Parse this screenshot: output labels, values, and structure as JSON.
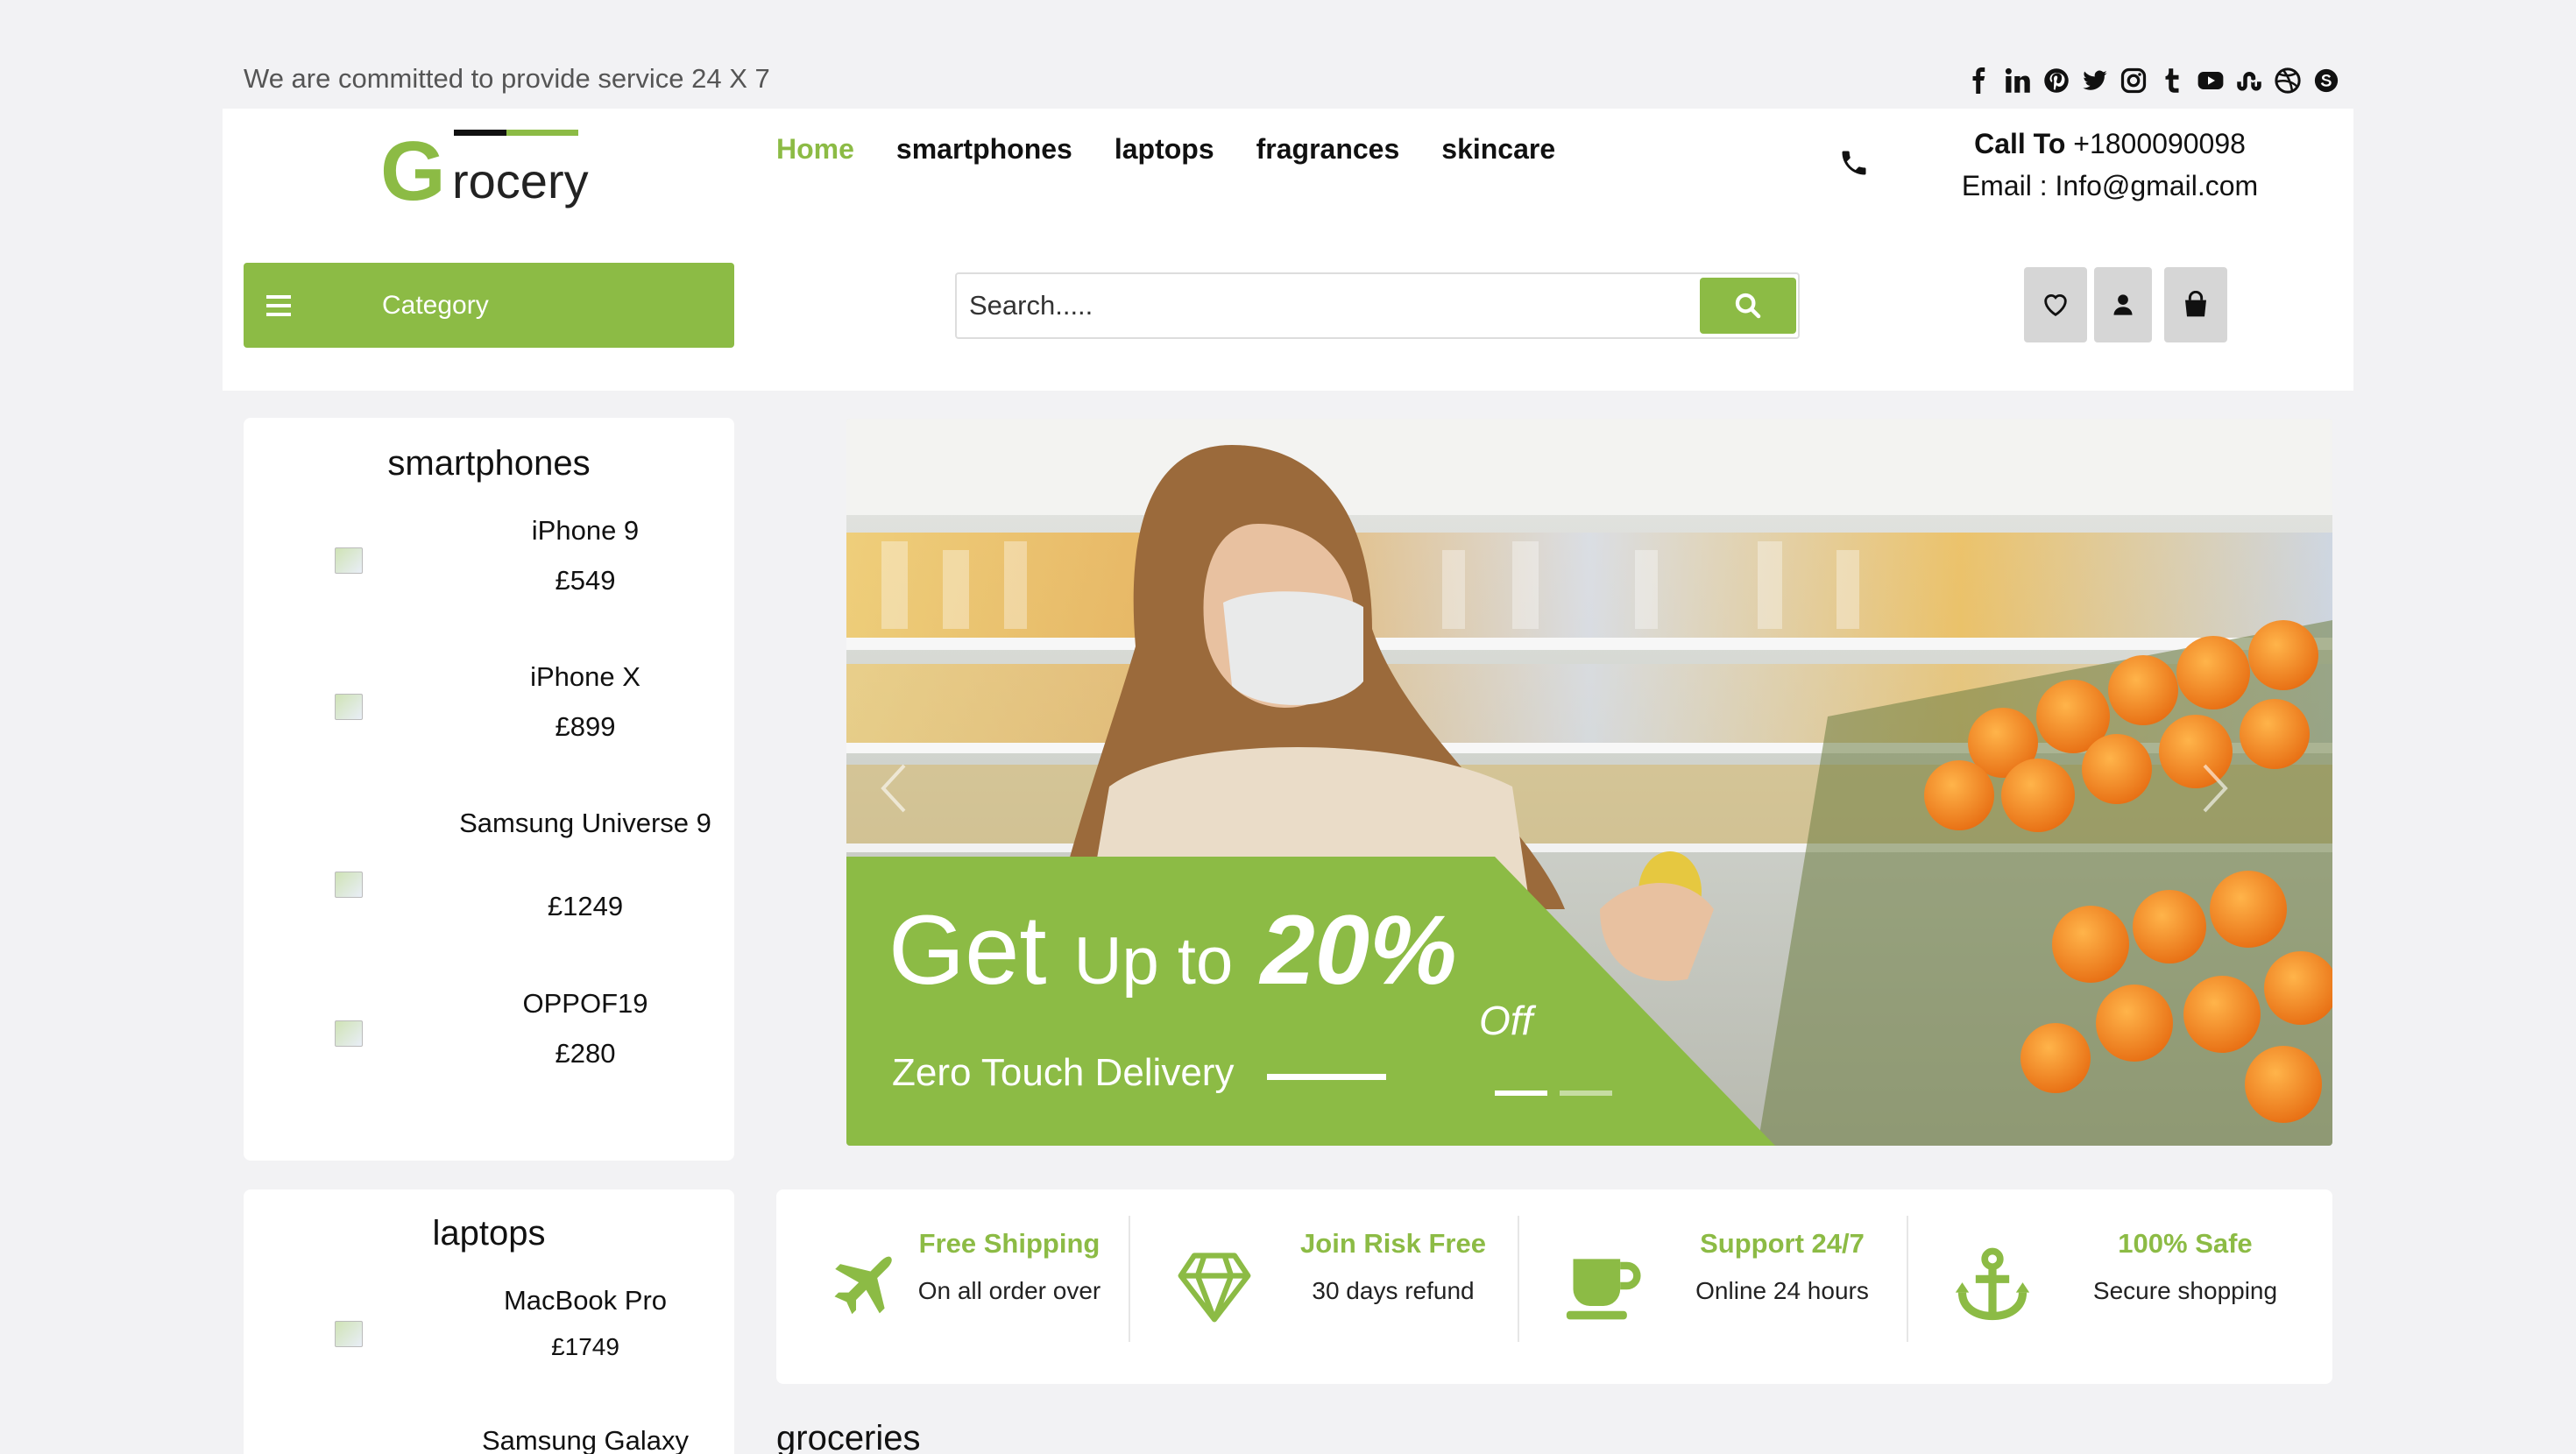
{
  "topbar": {
    "tagline": "We are committed to provide service 24 X 7",
    "socials": [
      "facebook-icon",
      "linkedin-icon",
      "pinterest-icon",
      "twitter-icon",
      "instagram-icon",
      "tumblr-icon",
      "youtube-icon",
      "stumbleupon-icon",
      "dribbble-icon",
      "skype-icon"
    ]
  },
  "header": {
    "logo_text": "rocery",
    "logo_letter": "G",
    "nav": [
      {
        "label": "Home",
        "active": true
      },
      {
        "label": "smartphones"
      },
      {
        "label": "laptops"
      },
      {
        "label": "fragrances"
      },
      {
        "label": "skincare"
      }
    ],
    "call_label": "Call To",
    "call_number": "+1800090098",
    "email_line": "Email : Info@gmail.com",
    "category_label": "Category",
    "search_placeholder": "Search....."
  },
  "sidebar": [
    {
      "title": "smartphones",
      "products": [
        {
          "name": "iPhone 9",
          "price": "£549"
        },
        {
          "name": "iPhone X",
          "price": "£899"
        },
        {
          "name": "Samsung Universe 9",
          "price": "£1249"
        },
        {
          "name": "OPPOF19",
          "price": "£280"
        }
      ]
    },
    {
      "title": "laptops",
      "products": [
        {
          "name": "MacBook Pro",
          "price": "£1749"
        },
        {
          "name": "Samsung Galaxy",
          "price": ""
        }
      ]
    }
  ],
  "hero": {
    "get": "Get",
    "up_to": "Up to",
    "percent": "20%",
    "off": "Off",
    "subtitle": "Zero Touch Delivery"
  },
  "features": [
    {
      "title": "Free Shipping",
      "subtitle": "On all order over",
      "icon": "airplane-icon"
    },
    {
      "title": "Join Risk Free",
      "subtitle": "30 days refund",
      "icon": "diamond-icon"
    },
    {
      "title": "Support 24/7",
      "subtitle": "Online 24 hours",
      "icon": "coffee-cup-icon"
    },
    {
      "title": "100% Safe",
      "subtitle": "Secure shopping",
      "icon": "anchor-icon"
    }
  ],
  "section_title": "groceries",
  "colors": {
    "accent": "#8cbb45",
    "background": "#f2f2f4"
  }
}
